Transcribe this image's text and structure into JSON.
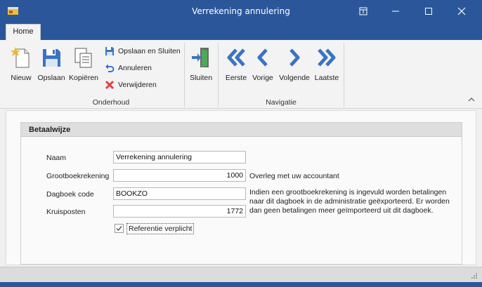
{
  "window": {
    "title": "Verrekening annulering",
    "controls": [
      "pin-icon",
      "minimize-icon",
      "maximize-icon",
      "close-icon"
    ]
  },
  "tabs": [
    {
      "label": "Home",
      "active": true
    }
  ],
  "ribbon": {
    "groups": [
      {
        "label": "Onderhoud",
        "large_buttons": [
          {
            "label": "Nieuw",
            "icon": "new-document-icon"
          },
          {
            "label": "Opslaan",
            "icon": "save-icon"
          },
          {
            "label": "Kopiëren",
            "icon": "copy-icon"
          }
        ],
        "small_buttons": [
          {
            "label": "Opslaan en Sluiten",
            "icon": "save-close-icon"
          },
          {
            "label": "Annuleren",
            "icon": "undo-icon"
          },
          {
            "label": "Verwijderen",
            "icon": "delete-icon"
          }
        ]
      },
      {
        "label": "",
        "large_buttons": [
          {
            "label": "Sluiten",
            "icon": "exit-door-icon"
          }
        ]
      },
      {
        "label": "Navigatie",
        "large_buttons": [
          {
            "label": "Eerste",
            "icon": "double-left-icon"
          },
          {
            "label": "Vorige",
            "icon": "left-icon"
          },
          {
            "label": "Volgende",
            "icon": "right-icon"
          },
          {
            "label": "Laatste",
            "icon": "double-right-icon"
          }
        ]
      }
    ]
  },
  "form": {
    "section_title": "Betaalwijze",
    "fields": [
      {
        "label": "Naam",
        "value": "Verrekening annulering"
      },
      {
        "label": "Grootboekrekening",
        "value": "1000",
        "note": "Overleg met uw accountant"
      },
      {
        "label": "Dagboek code",
        "value": "BOOKZO",
        "note": "Indien een grootboekrekening is ingevuld worden betalingen naar dit dagboek in de administratie geëxporteerd. Er worden dan geen betalingen meer geïmporteerd uit dit dagboek."
      },
      {
        "label": "Kruisposten",
        "value": "1772"
      }
    ],
    "checkbox": {
      "label": "Referentie verplicht",
      "checked": true
    }
  },
  "colors": {
    "titlebar": "#2b579a",
    "nav_icons": "#3b73c4",
    "delete": "#e04040"
  }
}
